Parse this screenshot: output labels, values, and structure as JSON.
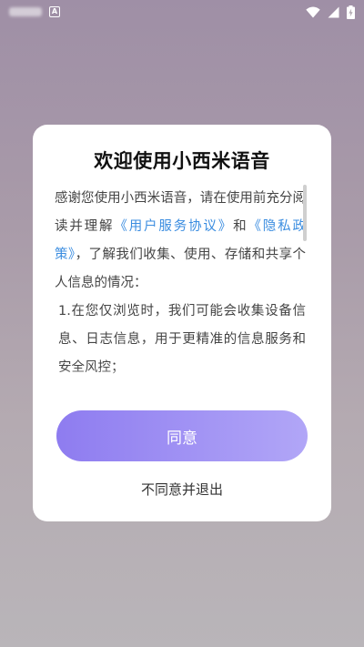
{
  "status_bar": {
    "notification_badge": "A",
    "icons": [
      "wifi-icon",
      "signal-icon",
      "battery-charging-icon"
    ]
  },
  "dialog": {
    "title": "欢迎使用小西米语音",
    "paragraphs": [
      {
        "before": "感谢您使用小西米语音，请在使用前充分阅读并理解",
        "link1": "《用户服务协议》",
        "middle": "和",
        "link2": "《隐私政策》",
        "after": "，了解我们收集、使用、存储和共享个人信息的情况："
      },
      {
        "text": "1.在您仅浏览时，我们可能会收集设备信息、日志信息，用于更精准的信息服务和安全风控；"
      }
    ],
    "agree_label": "同意",
    "disagree_label": "不同意并退出"
  },
  "colors": {
    "accent_start": "#8e7cf0",
    "accent_end": "#b1a6f7",
    "link": "#3b8de0"
  }
}
